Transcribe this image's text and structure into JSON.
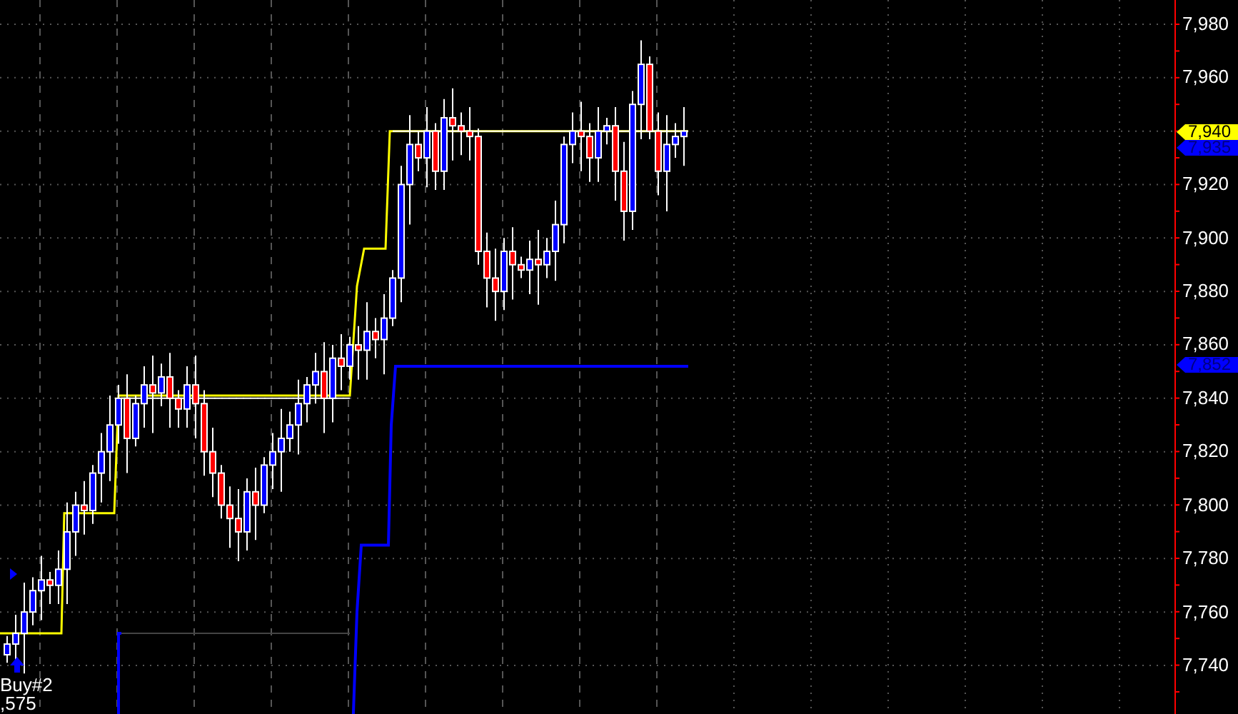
{
  "chart": {
    "price_axis": {
      "labels": [
        "7,980",
        "7,960",
        "7,920",
        "7,900",
        "7,880",
        "7,860",
        "7,840",
        "7,820",
        "7,800",
        "7,780",
        "7,760",
        "7,740"
      ]
    },
    "price_tags": [
      {
        "text": "7,940",
        "color": "#ffff00"
      },
      {
        "text": "7,935",
        "color": "#0000ff"
      },
      {
        "text": "7,852",
        "color": "#0000ff"
      }
    ],
    "trade_marker": {
      "label": "Buy#2",
      "price": ",575"
    }
  }
}
